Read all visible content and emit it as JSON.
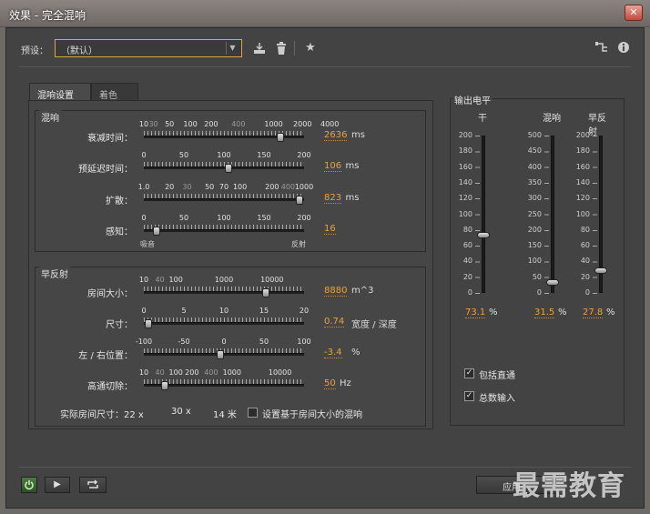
{
  "window": {
    "title": "效果 - 完全混响",
    "close_label": "✕"
  },
  "toolbar": {
    "preset_label": "预设：",
    "preset_value": "（默认）",
    "icons": [
      "save-preset-icon",
      "delete-icon",
      "favorite-star-icon",
      "routing-icon",
      "info-icon"
    ]
  },
  "tabs": [
    {
      "label": "混响设置",
      "active": true
    },
    {
      "label": "着色",
      "active": false
    }
  ],
  "reverb": {
    "title": "混响",
    "decay": {
      "label": "衰减时间：",
      "ticks": [
        "10",
        "30",
        "50",
        "100",
        "200",
        "400",
        "1000",
        "2000",
        "4000"
      ],
      "value": "2636",
      "unit": "ms",
      "fraction": 0.85
    },
    "predelay": {
      "label": "预延迟时间：",
      "ticks": [
        "0",
        "50",
        "100",
        "150",
        "200"
      ],
      "value": "106",
      "unit": "ms",
      "fraction": 0.53
    },
    "diffusion": {
      "label": "扩散：",
      "ticks": [
        "1.0",
        "20",
        "30",
        "50",
        "70",
        "100",
        "200",
        "400",
        "1000"
      ],
      "value": "823",
      "unit": "ms",
      "fraction": 0.97
    },
    "perception": {
      "label": "感知：",
      "ticks": [
        "0",
        "50",
        "100",
        "150",
        "200"
      ],
      "value": "16",
      "unit": "",
      "fraction": 0.08,
      "left_label": "吸音",
      "right_label": "反射"
    }
  },
  "early": {
    "title": "早反射",
    "room_size": {
      "label": "房间大小：",
      "ticks": [
        "10",
        "40",
        "100",
        "1000",
        "10000"
      ],
      "value": "8880",
      "unit": "m^3",
      "fraction": 0.76
    },
    "dimensions": {
      "label": "尺寸：",
      "ticks": [
        "0",
        "5",
        "10",
        "15",
        "20"
      ],
      "value": "0.74",
      "unit": "宽度 / 深度",
      "fraction": 0.03
    },
    "left_right": {
      "label": "左 / 右位置：",
      "ticks": [
        "-100",
        "-50",
        "0",
        "50",
        "100"
      ],
      "value": "-3.4",
      "unit": "%",
      "fraction": 0.48
    },
    "highpass": {
      "label": "高通切除：",
      "ticks": [
        "10",
        "40",
        "100",
        "200",
        "400",
        "1000",
        "10000"
      ],
      "value": "50",
      "unit": "Hz",
      "fraction": 0.13
    },
    "actual_room": {
      "label": "实际房间尺寸：22 x",
      "w": "30 x",
      "h": "14 米"
    },
    "set_based_label": "设置基于房间大小的混响",
    "set_based_checked": false
  },
  "output": {
    "title": "输出电平",
    "meters": [
      {
        "name": "干",
        "scale": [
          "200",
          "180",
          "160",
          "140",
          "120",
          "100",
          "80",
          "60",
          "40",
          "20",
          "0"
        ],
        "value": "73.1",
        "unit": "%",
        "fraction": 0.365
      },
      {
        "name": "混响",
        "scale": [
          "500",
          "450",
          "400",
          "350",
          "300",
          "250",
          "200",
          "150",
          "100",
          "50",
          "0"
        ],
        "value": "31.5",
        "unit": "%",
        "fraction": 0.063
      },
      {
        "name": "早反射",
        "scale": [
          "200",
          "180",
          "160",
          "140",
          "120",
          "100",
          "80",
          "60",
          "40",
          "20",
          "0"
        ],
        "value": "27.8",
        "unit": "%",
        "fraction": 0.139
      }
    ],
    "include_direct": {
      "label": "包括直通",
      "checked": true
    },
    "sum_inputs": {
      "label": "总数输入",
      "checked": true
    }
  },
  "footer": {
    "apply_label": "应用",
    "watermark": "最需教育"
  },
  "colors": {
    "accent_value": "#e8a33a",
    "preset_border": "#d4a84b",
    "power_on": "#4e7b44"
  }
}
